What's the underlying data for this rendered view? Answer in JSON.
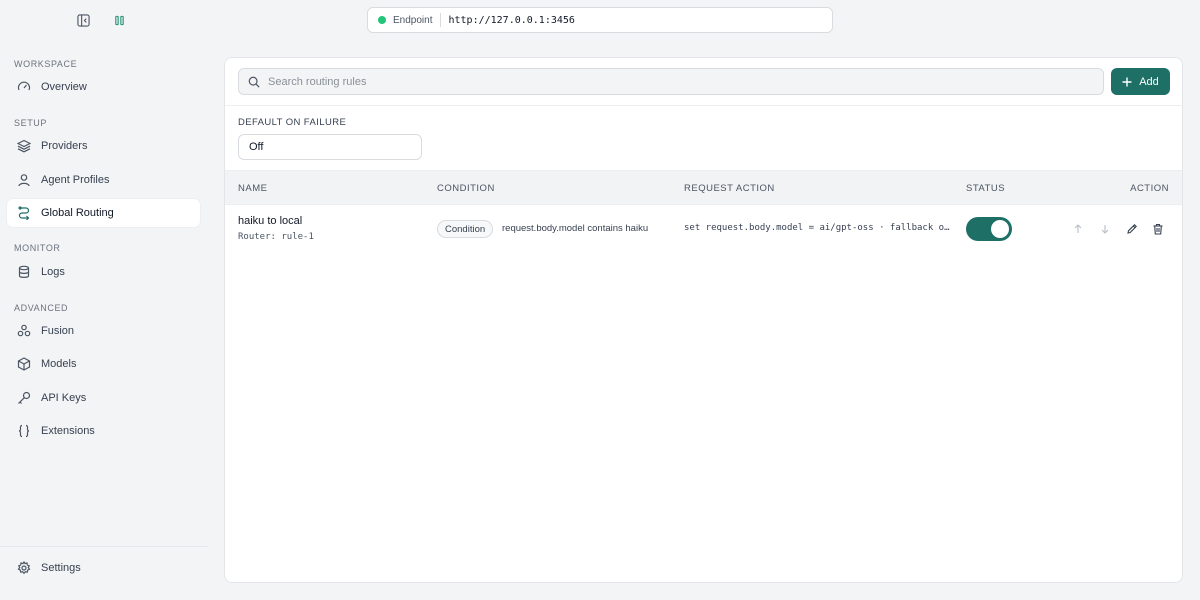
{
  "sidebar": {
    "sections": {
      "workspace": "WORKSPACE",
      "setup": "SETUP",
      "monitor": "MONITOR",
      "advanced": "ADVANCED"
    },
    "items": {
      "overview": "Overview",
      "providers": "Providers",
      "agent_profiles": "Agent Profiles",
      "global_routing": "Global Routing",
      "logs": "Logs",
      "fusion": "Fusion",
      "models": "Models",
      "api_keys": "API Keys",
      "extensions": "Extensions",
      "settings": "Settings"
    },
    "active_item": "global_routing"
  },
  "endpoint": {
    "label": "Endpoint",
    "url": "http://127.0.0.1:3456",
    "status_color": "#22c57a"
  },
  "toolbar": {
    "search_placeholder": "Search routing rules",
    "add_label": "Add"
  },
  "default_on_failure": {
    "label": "DEFAULT ON FAILURE",
    "value": "Off"
  },
  "table": {
    "headers": {
      "name": "NAME",
      "condition": "CONDITION",
      "request_action": "REQUEST ACTION",
      "status": "STATUS",
      "action": "ACTION"
    },
    "rows": [
      {
        "name": "haiku to local",
        "router": "Router: rule-1",
        "condition_badge": "Condition",
        "condition_text": "request.body.model contains haiku",
        "request_action": "set request.body.model = ai/gpt-oss · fallback o…",
        "enabled": true
      }
    ]
  },
  "colors": {
    "accent": "#1e6f66",
    "background": "#f3f4f5"
  }
}
